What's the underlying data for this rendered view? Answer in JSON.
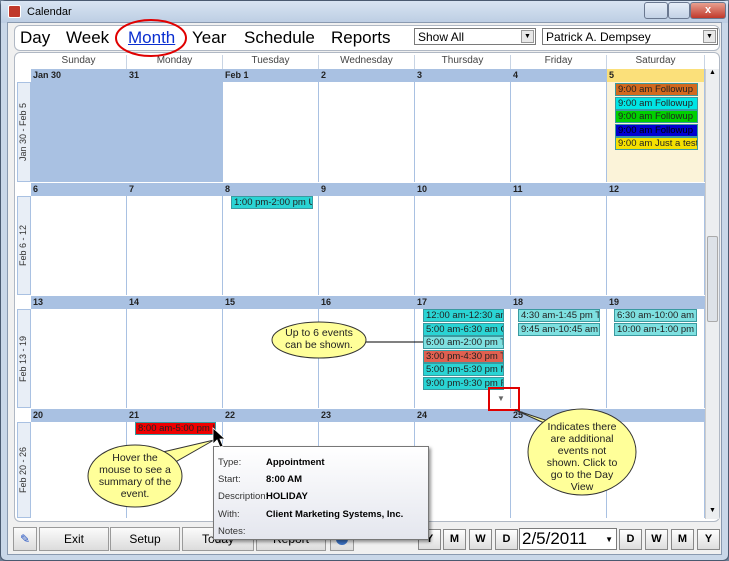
{
  "window": {
    "title": "Calendar",
    "close": "x"
  },
  "nav": {
    "items": [
      "Day",
      "Week",
      "Month",
      "Year",
      "Schedule",
      "Reports"
    ],
    "active": "Month",
    "filter": "Show All",
    "user": "Patrick A. Dempsey"
  },
  "days": [
    "Sunday",
    "Monday",
    "Tuesday",
    "Wednesday",
    "Thursday",
    "Friday",
    "Saturday"
  ],
  "weeks": [
    {
      "label": "Jan 30 - Feb 5",
      "dates": [
        "Jan 30",
        "31",
        "Feb 1",
        "2",
        "3",
        "4",
        "5"
      ]
    },
    {
      "label": "Feb 6 - 12",
      "dates": [
        "6",
        "7",
        "8",
        "9",
        "10",
        "11",
        "12"
      ]
    },
    {
      "label": "Feb 13 - 19",
      "dates": [
        "13",
        "14",
        "15",
        "16",
        "17",
        "18",
        "19"
      ]
    },
    {
      "label": "Feb 20 - 26",
      "dates": [
        "20",
        "21",
        "22",
        "23",
        "24",
        "25",
        ""
      ]
    }
  ],
  "events": {
    "sat5": [
      {
        "t": "9:00 am Followup",
        "c": "#d2691e"
      },
      {
        "t": "9:00 am Followup",
        "c": "#00e5e5"
      },
      {
        "t": "9:00 am Followup",
        "c": "#00d000"
      },
      {
        "t": "9:00 am Followup",
        "c": "#0000d0"
      },
      {
        "t": "9:00 am Just a test",
        "c": "#f5e000"
      }
    ],
    "tue8": [
      {
        "t": "1:00 pm-2:00 pm U",
        "c": "#2ad4d4"
      }
    ],
    "thu17": [
      {
        "t": "12:00 am-12:30 am",
        "c": "#2ad4d4"
      },
      {
        "t": "5:00 am-6:30 am Cc",
        "c": "#2ad4d4"
      },
      {
        "t": "6:00 am-2:00 pm Tr",
        "c": "#7ee0e0"
      },
      {
        "t": "3:00 pm-4:30 pm Tr",
        "c": "#e06050"
      },
      {
        "t": "5:00 pm-5:30 pm M",
        "c": "#2ad4d4"
      },
      {
        "t": "9:00 pm-9:30 pm R",
        "c": "#2ad4d4"
      }
    ],
    "fri18": [
      {
        "t": "4:30 am-1:45 pm Tr",
        "c": "#7ee0e0"
      },
      {
        "t": "9:45 am-10:45 am T",
        "c": "#7ee0e0"
      }
    ],
    "sat19": [
      {
        "t": "6:30 am-10:00 am T",
        "c": "#7ee0e0"
      },
      {
        "t": "10:00 am-1:00 pm T",
        "c": "#7ee0e0"
      }
    ],
    "mon21": [
      {
        "t": "8:00 am-5:00 pm H",
        "c": "#ee0000"
      }
    ]
  },
  "tooltip": {
    "type_l": "Type:",
    "type": "Appointment",
    "start_l": "Start:",
    "start": "8:00 AM",
    "desc_l": "Description:",
    "desc": "HOLIDAY",
    "with_l": "With:",
    "with": "Client Marketing Systems, Inc.",
    "notes_l": "Notes:"
  },
  "callouts": {
    "events": "Up to 6 events can be shown.",
    "hover": "Hover the mouse to see a summary of the event.",
    "more": "Indicates there are additional events not shown.  Click to go to the Day View"
  },
  "footer": {
    "exit": "Exit",
    "setup": "Setup",
    "today": "Today",
    "report": "Report",
    "date": "2/5/2011",
    "back": [
      "Y",
      "M",
      "W",
      "D"
    ],
    "fwd": [
      "D",
      "W",
      "M",
      "Y"
    ]
  }
}
